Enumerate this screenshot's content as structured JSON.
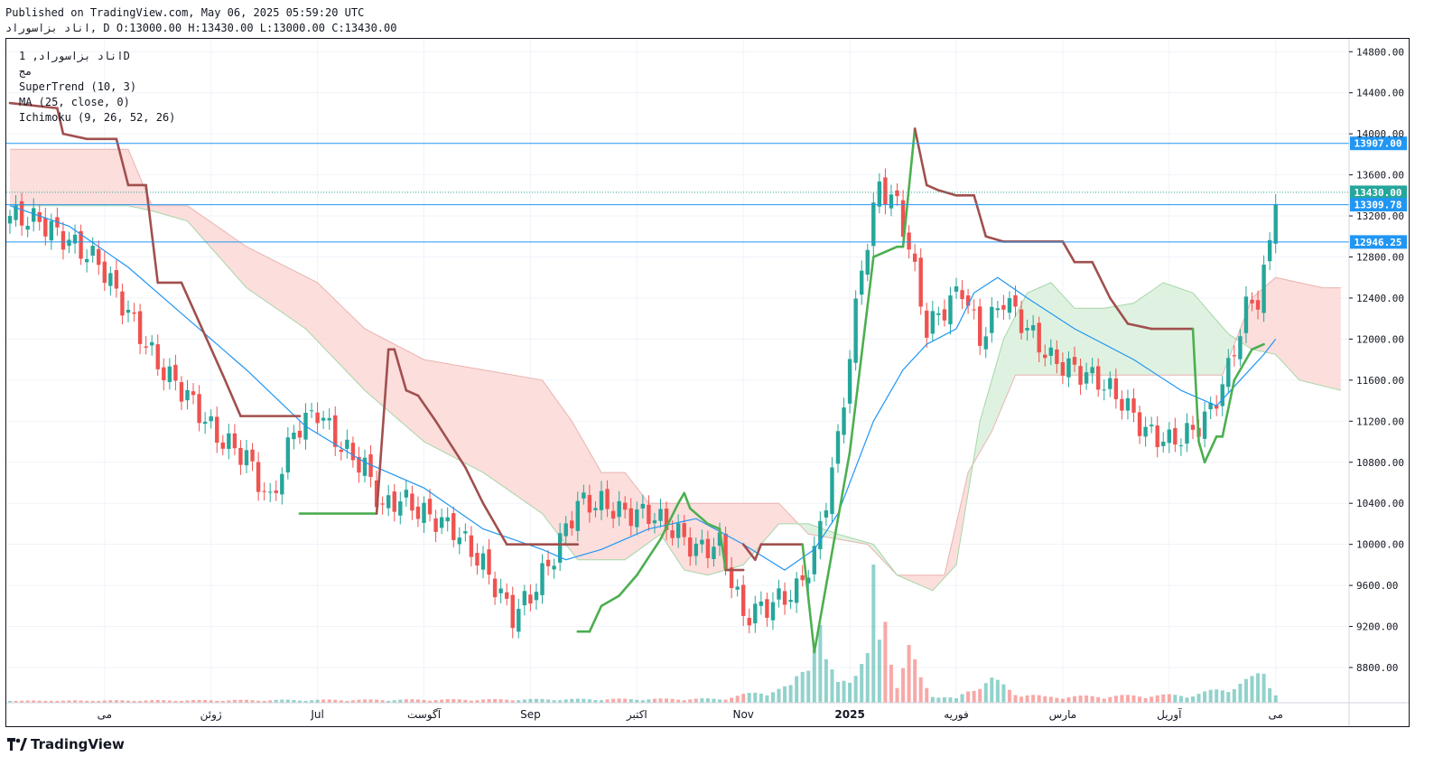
{
  "header": {
    "published": "Published on TradingView.com, May 06, 2025 05:59:20 UTC",
    "ohlc": "اناد بزاسوراد, D O:13000.00 H:13430.00 L:13000.00 C:13430.00"
  },
  "legend": {
    "symbol": "اناد بزاسوراد, 1D",
    "line2": "مج",
    "supertrend": "SuperTrend (10, 3)",
    "ma": "MA (25, close, 0)",
    "ichimoku": "Ichimoku (9, 26, 52, 26)"
  },
  "brand": {
    "name": "TradingView"
  },
  "colors": {
    "up": "#26a69a",
    "down": "#ef5350",
    "supertrend_up": "#4caf50",
    "supertrend_down": "#a0504e",
    "ma": "#2196f3",
    "cloud_red": "#fbd8d6",
    "cloud_green": "#d9f0dc",
    "hline": "#2196f3",
    "last_price": "#26a69a"
  },
  "chart_data": {
    "type": "candlestick",
    "y_range": [
      8500,
      14900
    ],
    "y_ticks": [
      "14800.00",
      "14400.00",
      "14000.00",
      "13600.00",
      "13200.00",
      "12800.00",
      "12400.00",
      "12000.00",
      "11600.00",
      "11200.00",
      "10800.00",
      "10400.00",
      "10000.00",
      "9600.00",
      "9200.00",
      "8800.00"
    ],
    "x_ticks": [
      "می",
      "ژوئن",
      "Jul",
      "آگوست",
      "Sep",
      "اکتبر",
      "Nov",
      "2025",
      "فوریه",
      "مارس",
      "آوریل",
      "می"
    ],
    "x_tick_bars": [
      16,
      34,
      52,
      70,
      88,
      106,
      124,
      142,
      160,
      178,
      196,
      214
    ],
    "bars": 232,
    "price_labels": [
      {
        "value": 13907.0,
        "text": "13907.00",
        "kind": "hline"
      },
      {
        "value": 13430.0,
        "text": "13430.00",
        "kind": "last"
      },
      {
        "value": 13309.78,
        "text": "13309.78",
        "kind": "hline"
      },
      {
        "value": 12946.25,
        "text": "12946.25",
        "kind": "hline"
      }
    ],
    "close_anchors": [
      [
        0,
        13200
      ],
      [
        5,
        13150
      ],
      [
        10,
        12950
      ],
      [
        15,
        12750
      ],
      [
        20,
        12250
      ],
      [
        25,
        11750
      ],
      [
        30,
        11450
      ],
      [
        35,
        11050
      ],
      [
        40,
        10850
      ],
      [
        44,
        10400
      ],
      [
        48,
        11100
      ],
      [
        52,
        11300
      ],
      [
        56,
        10950
      ],
      [
        60,
        10750
      ],
      [
        63,
        10350
      ],
      [
        66,
        10450
      ],
      [
        70,
        10300
      ],
      [
        75,
        10150
      ],
      [
        80,
        9800
      ],
      [
        85,
        9300
      ],
      [
        88,
        9500
      ],
      [
        92,
        9900
      ],
      [
        96,
        10400
      ],
      [
        100,
        10400
      ],
      [
        104,
        10300
      ],
      [
        108,
        10300
      ],
      [
        112,
        10150
      ],
      [
        116,
        9950
      ],
      [
        120,
        10000
      ],
      [
        124,
        9300
      ],
      [
        128,
        9400
      ],
      [
        133,
        9550
      ],
      [
        136,
        9900
      ],
      [
        140,
        11000
      ],
      [
        144,
        12700
      ],
      [
        147,
        13500
      ],
      [
        150,
        13300
      ],
      [
        152,
        12900
      ],
      [
        155,
        12100
      ],
      [
        158,
        12300
      ],
      [
        161,
        12500
      ],
      [
        164,
        12000
      ],
      [
        168,
        12400
      ],
      [
        172,
        12100
      ],
      [
        176,
        11800
      ],
      [
        180,
        11700
      ],
      [
        184,
        11600
      ],
      [
        188,
        11400
      ],
      [
        192,
        11100
      ],
      [
        196,
        11000
      ],
      [
        200,
        11100
      ],
      [
        203,
        11300
      ],
      [
        206,
        11700
      ],
      [
        209,
        12300
      ],
      [
        211,
        12400
      ],
      [
        213,
        12900
      ],
      [
        214,
        13430
      ]
    ],
    "volume_anchors": [
      [
        0,
        0.01
      ],
      [
        120,
        0.02
      ],
      [
        132,
        0.08
      ],
      [
        134,
        0.18
      ],
      [
        135,
        0.25
      ],
      [
        136,
        0.34
      ],
      [
        137,
        0.4
      ],
      [
        138,
        0.2
      ],
      [
        140,
        0.1
      ],
      [
        142,
        0.15
      ],
      [
        145,
        0.23
      ],
      [
        146,
        0.62
      ],
      [
        147,
        0.3
      ],
      [
        148,
        0.45
      ],
      [
        150,
        0.1
      ],
      [
        152,
        0.27
      ],
      [
        154,
        0.12
      ],
      [
        156,
        0.04
      ],
      [
        160,
        0.02
      ],
      [
        164,
        0.1
      ],
      [
        166,
        0.12
      ],
      [
        170,
        0.05
      ],
      [
        175,
        0.03
      ],
      [
        200,
        0.04
      ],
      [
        205,
        0.07
      ],
      [
        210,
        0.12
      ],
      [
        212,
        0.16
      ],
      [
        214,
        0.05
      ]
    ],
    "supertrend": [
      [
        0,
        14300
      ],
      [
        8,
        14250
      ],
      [
        9,
        14000
      ],
      [
        13,
        13950
      ],
      [
        18,
        13950
      ],
      [
        20,
        13500
      ],
      [
        23,
        13500
      ],
      [
        25,
        12550
      ],
      [
        29,
        12550
      ],
      [
        36,
        11650
      ],
      [
        39,
        11250
      ],
      [
        49,
        11250
      ],
      [
        49,
        10300
      ],
      [
        62,
        10300
      ],
      [
        64,
        11900
      ],
      [
        65,
        11900
      ],
      [
        67,
        11500
      ],
      [
        69,
        11450
      ],
      [
        72,
        11200
      ],
      [
        77,
        10750
      ],
      [
        80,
        10400
      ],
      [
        84,
        10000
      ],
      [
        96,
        10000
      ],
      [
        96,
        9150
      ],
      [
        98,
        9150
      ],
      [
        100,
        9400
      ],
      [
        103,
        9500
      ],
      [
        106,
        9700
      ],
      [
        110,
        10050
      ],
      [
        113,
        10400
      ],
      [
        114,
        10500
      ],
      [
        115,
        10350
      ],
      [
        118,
        10200
      ],
      [
        120,
        10150
      ],
      [
        121,
        9750
      ],
      [
        124,
        9750
      ],
      [
        124,
        10000
      ],
      [
        126,
        9850
      ],
      [
        127,
        10000
      ],
      [
        134,
        10000
      ],
      [
        136,
        8950
      ],
      [
        138,
        9600
      ],
      [
        142,
        10900
      ],
      [
        146,
        12800
      ],
      [
        150,
        12900
      ],
      [
        151,
        12900
      ],
      [
        153,
        14050
      ],
      [
        155,
        13500
      ],
      [
        157,
        13450
      ],
      [
        160,
        13400
      ],
      [
        163,
        13400
      ],
      [
        165,
        13000
      ],
      [
        168,
        12950
      ],
      [
        178,
        12950
      ],
      [
        180,
        12750
      ],
      [
        183,
        12750
      ],
      [
        186,
        12400
      ],
      [
        189,
        12150
      ],
      [
        193,
        12100
      ],
      [
        200,
        12100
      ],
      [
        201,
        11000
      ],
      [
        202,
        10800
      ],
      [
        204,
        11050
      ],
      [
        205,
        11050
      ],
      [
        207,
        11600
      ],
      [
        210,
        11900
      ],
      [
        212,
        11950
      ]
    ],
    "ma": [
      [
        0,
        13300
      ],
      [
        10,
        13100
      ],
      [
        20,
        12700
      ],
      [
        30,
        12200
      ],
      [
        40,
        11700
      ],
      [
        50,
        11150
      ],
      [
        60,
        10800
      ],
      [
        70,
        10550
      ],
      [
        80,
        10150
      ],
      [
        90,
        9950
      ],
      [
        94,
        9850
      ],
      [
        100,
        9950
      ],
      [
        108,
        10150
      ],
      [
        116,
        10250
      ],
      [
        124,
        10000
      ],
      [
        131,
        9750
      ],
      [
        136,
        9950
      ],
      [
        140,
        10300
      ],
      [
        146,
        11200
      ],
      [
        151,
        11700
      ],
      [
        155,
        11950
      ],
      [
        160,
        12100
      ],
      [
        163,
        12450
      ],
      [
        167,
        12600
      ],
      [
        172,
        12400
      ],
      [
        180,
        12100
      ],
      [
        190,
        11800
      ],
      [
        198,
        11500
      ],
      [
        204,
        11350
      ],
      [
        208,
        11600
      ],
      [
        212,
        11850
      ],
      [
        214,
        12000
      ]
    ],
    "cloud_a": [
      [
        0,
        13850
      ],
      [
        20,
        13850
      ],
      [
        24,
        13300
      ],
      [
        30,
        13300
      ],
      [
        40,
        12900
      ],
      [
        52,
        12550
      ],
      [
        60,
        12100
      ],
      [
        70,
        11800
      ],
      [
        80,
        11700
      ],
      [
        90,
        11600
      ],
      [
        95,
        11200
      ],
      [
        100,
        10700
      ],
      [
        104,
        10700
      ],
      [
        108,
        10400
      ],
      [
        114,
        10400
      ],
      [
        130,
        10400
      ],
      [
        135,
        10100
      ],
      [
        145,
        10000
      ],
      [
        150,
        9700
      ],
      [
        153,
        9700
      ],
      [
        158,
        9700
      ],
      [
        162,
        10700
      ],
      [
        166,
        11100
      ],
      [
        170,
        11650
      ],
      [
        180,
        11650
      ],
      [
        190,
        11650
      ],
      [
        200,
        11650
      ],
      [
        205,
        11650
      ],
      [
        210,
        12400
      ],
      [
        214,
        12600
      ],
      [
        222,
        12500
      ],
      [
        225,
        12500
      ]
    ],
    "cloud_b": [
      [
        0,
        13300
      ],
      [
        20,
        13300
      ],
      [
        24,
        13250
      ],
      [
        30,
        13150
      ],
      [
        40,
        12500
      ],
      [
        50,
        12100
      ],
      [
        60,
        11500
      ],
      [
        70,
        11000
      ],
      [
        80,
        10700
      ],
      [
        90,
        10300
      ],
      [
        96,
        9850
      ],
      [
        104,
        9850
      ],
      [
        110,
        10100
      ],
      [
        114,
        9750
      ],
      [
        118,
        9700
      ],
      [
        124,
        9800
      ],
      [
        130,
        10200
      ],
      [
        135,
        10200
      ],
      [
        140,
        10100
      ],
      [
        146,
        10000
      ],
      [
        150,
        9700
      ],
      [
        156,
        9550
      ],
      [
        160,
        9800
      ],
      [
        164,
        11200
      ],
      [
        168,
        12000
      ],
      [
        172,
        12450
      ],
      [
        176,
        12550
      ],
      [
        180,
        12300
      ],
      [
        185,
        12300
      ],
      [
        190,
        12350
      ],
      [
        195,
        12550
      ],
      [
        200,
        12450
      ],
      [
        206,
        12050
      ],
      [
        210,
        11900
      ],
      [
        214,
        11850
      ],
      [
        218,
        11600
      ],
      [
        225,
        11500
      ]
    ]
  }
}
